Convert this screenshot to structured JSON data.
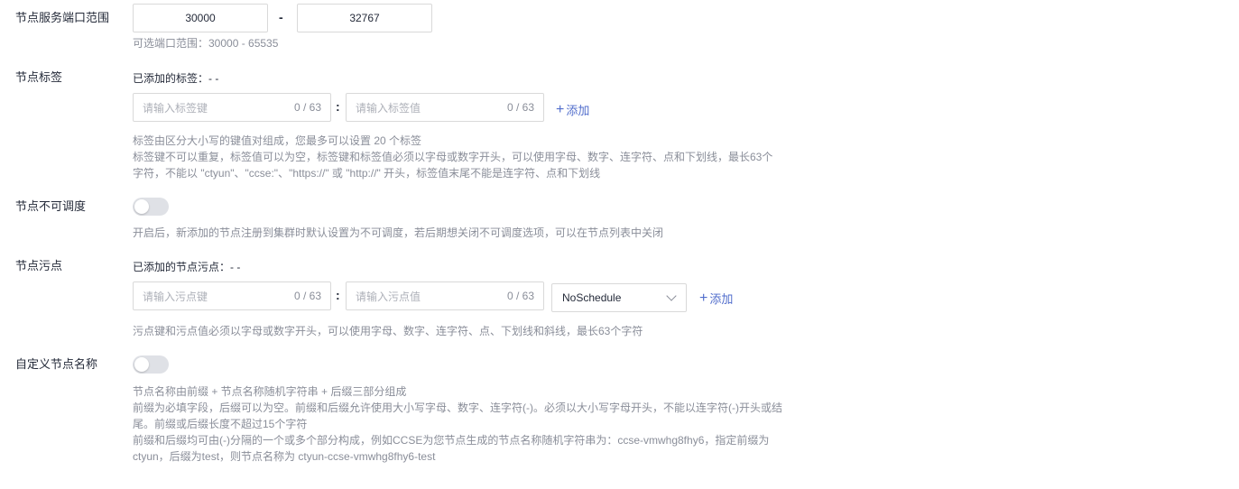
{
  "port_range": {
    "label": "节点服务端口范围",
    "min_value": "30000",
    "dash": "-",
    "max_value": "32767",
    "hint": "可选端口范围：30000 - 65535"
  },
  "node_labels": {
    "label": "节点标签",
    "added_text": "已添加的标签：- -",
    "key_placeholder": "请输入标签键",
    "key_count": "0 / 63",
    "colon": ":",
    "value_placeholder": "请输入标签值",
    "value_count": "0 / 63",
    "add_plus": "+",
    "add_label": "添加",
    "hint_lines": [
      "标签由区分大小写的键值对组成，您最多可以设置 20 个标签",
      "标签键不可以重复，标签值可以为空，标签键和标签值必须以字母或数字开头，可以使用字母、数字、连字符、点和下划线，最长63个",
      "字符，不能以 \"ctyun\"、\"ccse:\"、\"https://\" 或 \"http://\" 开头，标签值末尾不能是连字符、点和下划线"
    ]
  },
  "unschedulable": {
    "label": "节点不可调度",
    "enabled": false,
    "hint": "开启后，新添加的节点注册到集群时默认设置为不可调度，若后期想关闭不可调度选项，可以在节点列表中关闭"
  },
  "taints": {
    "label": "节点污点",
    "added_text": "已添加的节点污点：- -",
    "key_placeholder": "请输入污点键",
    "key_count": "0 / 63",
    "colon": ":",
    "value_placeholder": "请输入污点值",
    "value_count": "0 / 63",
    "effect_value": "NoSchedule",
    "add_plus": "+",
    "add_label": "添加",
    "hint": "污点键和污点值必须以字母或数字开头，可以使用字母、数字、连字符、点、下划线和斜线，最长63个字符"
  },
  "custom_name": {
    "label": "自定义节点名称",
    "enabled": false,
    "hint_lines": [
      "节点名称由前缀 + 节点名称随机字符串 + 后缀三部分组成",
      "前缀为必填字段，后缀可以为空。前缀和后缀允许使用大小写字母、数字、连字符(-)。必须以大小写字母开头，不能以连字符(-)开头或结",
      "尾。前缀或后缀长度不超过15个字符",
      "前缀和后缀均可由(-)分隔的一个或多个部分构成，例如CCSE为您节点生成的节点名称随机字符串为：ccse-vmwhg8fhy6，指定前缀为",
      "ctyun，后缀为test，则节点名称为 ctyun-ccse-vmwhg8fhy6-test"
    ]
  },
  "colors": {
    "link": "#526ecc",
    "hint_text": "#8a8e99",
    "toggle_off": "#dfe1e6"
  }
}
